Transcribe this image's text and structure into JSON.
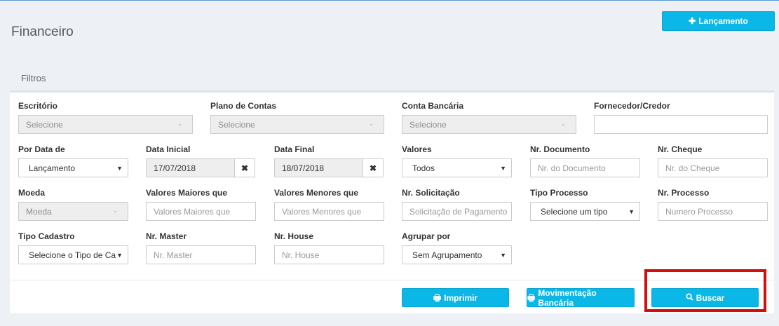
{
  "header": {
    "title": "Financeiro",
    "new_button": "Lançamento"
  },
  "filters_tab": "Filtros",
  "fields": {
    "escritorio": {
      "label": "Escritório",
      "value": "Selecione"
    },
    "plano_contas": {
      "label": "Plano de Contas",
      "value": "Selecione"
    },
    "conta_bancaria": {
      "label": "Conta Bancária",
      "value": "Selecione"
    },
    "fornecedor": {
      "label": "Fornecedor/Credor",
      "value": ""
    },
    "por_data": {
      "label": "Por Data de",
      "value": "Lançamento"
    },
    "data_inicial": {
      "label": "Data Inicial",
      "value": "17/07/2018"
    },
    "data_final": {
      "label": "Data Final",
      "value": "18/07/2018"
    },
    "valores": {
      "label": "Valores",
      "value": "Todos"
    },
    "nr_documento": {
      "label": "Nr. Documento",
      "placeholder": "Nr. do Documento"
    },
    "nr_cheque": {
      "label": "Nr. Cheque",
      "placeholder": "Nr. do Cheque"
    },
    "moeda": {
      "label": "Moeda",
      "value": "Moeda"
    },
    "valores_maiores": {
      "label": "Valores Maiores que",
      "placeholder": "Valores Maiores que"
    },
    "valores_menores": {
      "label": "Valores Menores que",
      "placeholder": "Valores Menores que"
    },
    "nr_solicitacao": {
      "label": "Nr. Solicitação",
      "placeholder": "Solicitação de Pagamento"
    },
    "tipo_processo": {
      "label": "Tipo Processo",
      "value": "Selecione um tipo"
    },
    "nr_processo": {
      "label": "Nr. Processo",
      "placeholder": "Numero Processo"
    },
    "tipo_cadastro": {
      "label": "Tipo Cadastro",
      "value": "Selecione o Tipo de Ca"
    },
    "nr_master": {
      "label": "Nr. Master",
      "placeholder": "Nr. Master"
    },
    "nr_house": {
      "label": "Nr. House",
      "placeholder": "Nr. House"
    },
    "agrupar_por": {
      "label": "Agrupar por",
      "value": "Sem Agrupamento"
    }
  },
  "actions": {
    "imprimir": "Imprimir",
    "movimentacao": "Movimentação Bancária",
    "buscar": "Buscar"
  },
  "colors": {
    "accent": "#0bb7e6",
    "highlight": "#d10f0f"
  }
}
